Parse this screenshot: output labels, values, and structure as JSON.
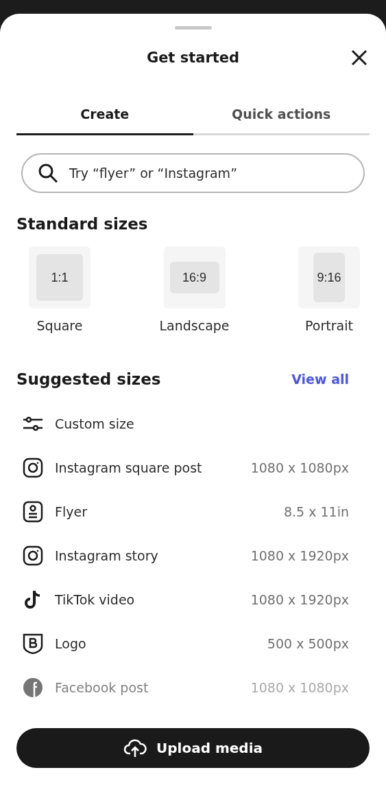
{
  "sheet": {
    "title": "Get started"
  },
  "tabs": [
    {
      "label": "Create",
      "selected": true
    },
    {
      "label": "Quick actions",
      "selected": false
    }
  ],
  "search": {
    "placeholder": "Try “flyer” or “Instagram”"
  },
  "standard_sizes": {
    "heading": "Standard sizes",
    "items": [
      {
        "kind": "square",
        "ratio": "1:1",
        "label": "Square"
      },
      {
        "kind": "landscape",
        "ratio": "16:9",
        "label": "Landscape"
      },
      {
        "kind": "portrait",
        "ratio": "9:16",
        "label": "Portrait"
      }
    ]
  },
  "suggested_sizes": {
    "heading": "Suggested sizes",
    "link": "View all",
    "items": [
      {
        "kind": "sliders",
        "name": "Custom size",
        "faded": false
      },
      {
        "kind": "instagram",
        "name": "Instagram square post",
        "size": "1080 x 1080px",
        "faded": false
      },
      {
        "kind": "flyer",
        "name": "Flyer",
        "size": "8.5 x 11in",
        "faded": false
      },
      {
        "kind": "instagram",
        "name": "Instagram story",
        "size": "1080 x 1920px",
        "faded": false
      },
      {
        "kind": "tiktok",
        "name": "TikTok video",
        "size": "1080 x 1920px",
        "faded": false
      },
      {
        "kind": "logo",
        "name": "Logo",
        "size": "500 x 500px",
        "faded": false
      },
      {
        "kind": "facebook",
        "name": "Facebook post",
        "size": "1080 x 1080px",
        "faded": true
      }
    ]
  },
  "upload_button": {
    "label": "Upload media"
  }
}
